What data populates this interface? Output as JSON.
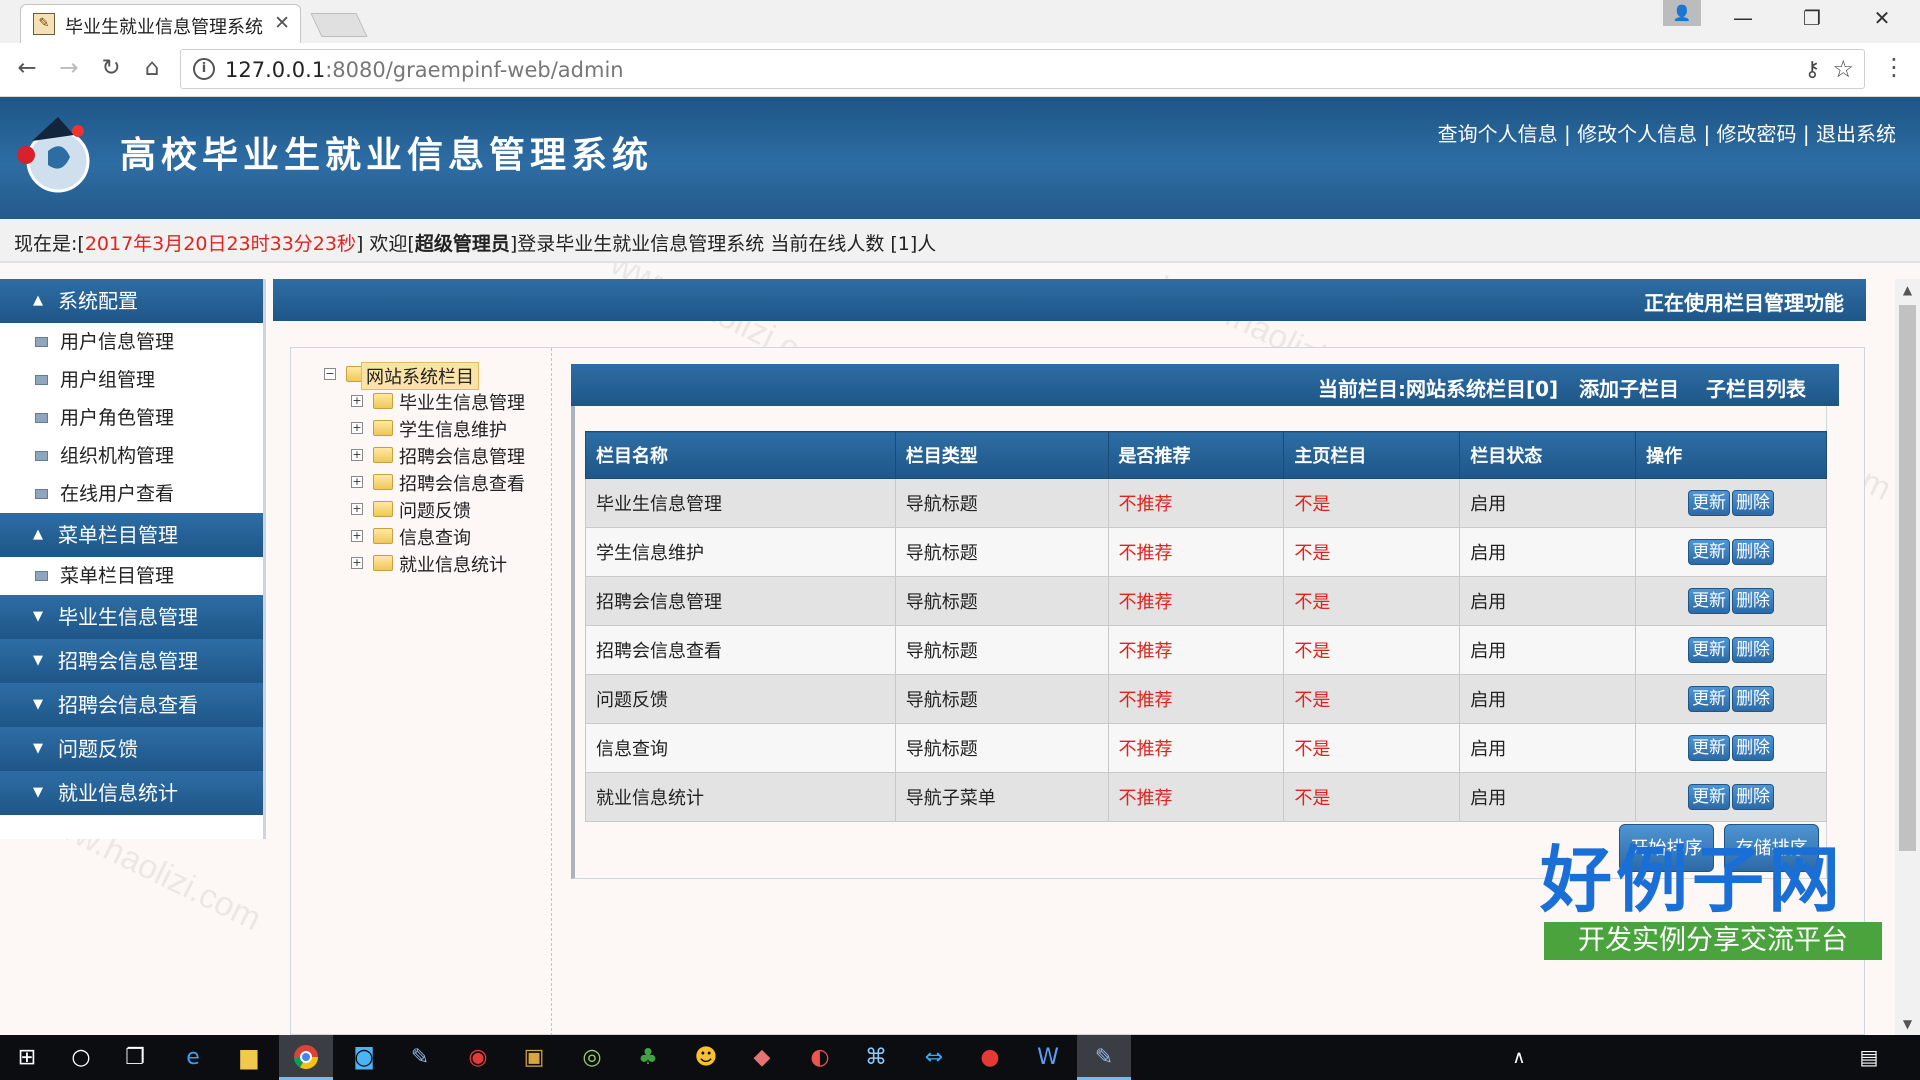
{
  "browser": {
    "tab_title": "毕业生就业信息管理系统",
    "url_host": "127.0.0.1",
    "url_rest": ":8080/graempinf-web/admin"
  },
  "header": {
    "site_title": "高校毕业生就业信息管理系统",
    "links": [
      "查询个人信息",
      "修改个人信息",
      "修改密码",
      "退出系统"
    ],
    "separator": " | "
  },
  "status": {
    "prefix": "现在是:[",
    "datetime": "2017年3月20日23时33分23秒",
    "mid1": "] 欢迎[",
    "role": "超级管理员",
    "mid2": "]登录毕业生就业信息管理系统 当前在线人数 [1]人"
  },
  "sidebar": {
    "groups": [
      {
        "label": "系统配置",
        "items": [
          "用户信息管理",
          "用户组管理",
          "用户角色管理",
          "组织机构管理",
          "在线用户查看"
        ]
      },
      {
        "label": "菜单栏目管理",
        "items": [
          "菜单栏目管理"
        ]
      },
      {
        "label": "毕业生信息管理",
        "items": []
      },
      {
        "label": "招聘会信息管理",
        "items": []
      },
      {
        "label": "招聘会信息查看",
        "items": []
      },
      {
        "label": "问题反馈",
        "items": []
      },
      {
        "label": "就业信息统计",
        "items": []
      }
    ]
  },
  "main": {
    "heading": "正在使用栏目管理功能"
  },
  "tree": {
    "root": "网站系统栏目",
    "children": [
      "毕业生信息管理",
      "学生信息维护",
      "招聘会信息管理",
      "招聘会信息查看",
      "问题反馈",
      "信息查询",
      "就业信息统计"
    ]
  },
  "content": {
    "current": "当前栏目:网站系统栏目[0]",
    "add_child": "添加子栏目",
    "child_list": "子栏目列表"
  },
  "table": {
    "columns": [
      "栏目名称",
      "栏目类型",
      "是否推荐",
      "主页栏目",
      "栏目状态",
      "操作"
    ],
    "rows": [
      [
        "毕业生信息管理",
        "导航标题",
        "不推荐",
        "不是",
        "启用"
      ],
      [
        "学生信息维护",
        "导航标题",
        "不推荐",
        "不是",
        "启用"
      ],
      [
        "招聘会信息管理",
        "导航标题",
        "不推荐",
        "不是",
        "启用"
      ],
      [
        "招聘会信息查看",
        "导航标题",
        "不推荐",
        "不是",
        "启用"
      ],
      [
        "问题反馈",
        "导航标题",
        "不推荐",
        "不是",
        "启用"
      ],
      [
        "信息查询",
        "导航标题",
        "不推荐",
        "不是",
        "启用"
      ],
      [
        "就业信息统计",
        "导航子菜单",
        "不推荐",
        "不是",
        "启用"
      ]
    ],
    "update_label": "更新",
    "delete_label": "删除"
  },
  "actions": {
    "start_sort": "开始排序",
    "save_sort": "存储排序"
  },
  "watermark": {
    "text": "www.haolizi.com",
    "brand_big": "好例子网",
    "brand_small": "开发实例分享交流平台"
  },
  "colors": {
    "header_blue": "#2d6da4",
    "accent_red": "#e0231f",
    "brand_blue": "#1a6fd6",
    "brand_green": "#4aa33d"
  }
}
